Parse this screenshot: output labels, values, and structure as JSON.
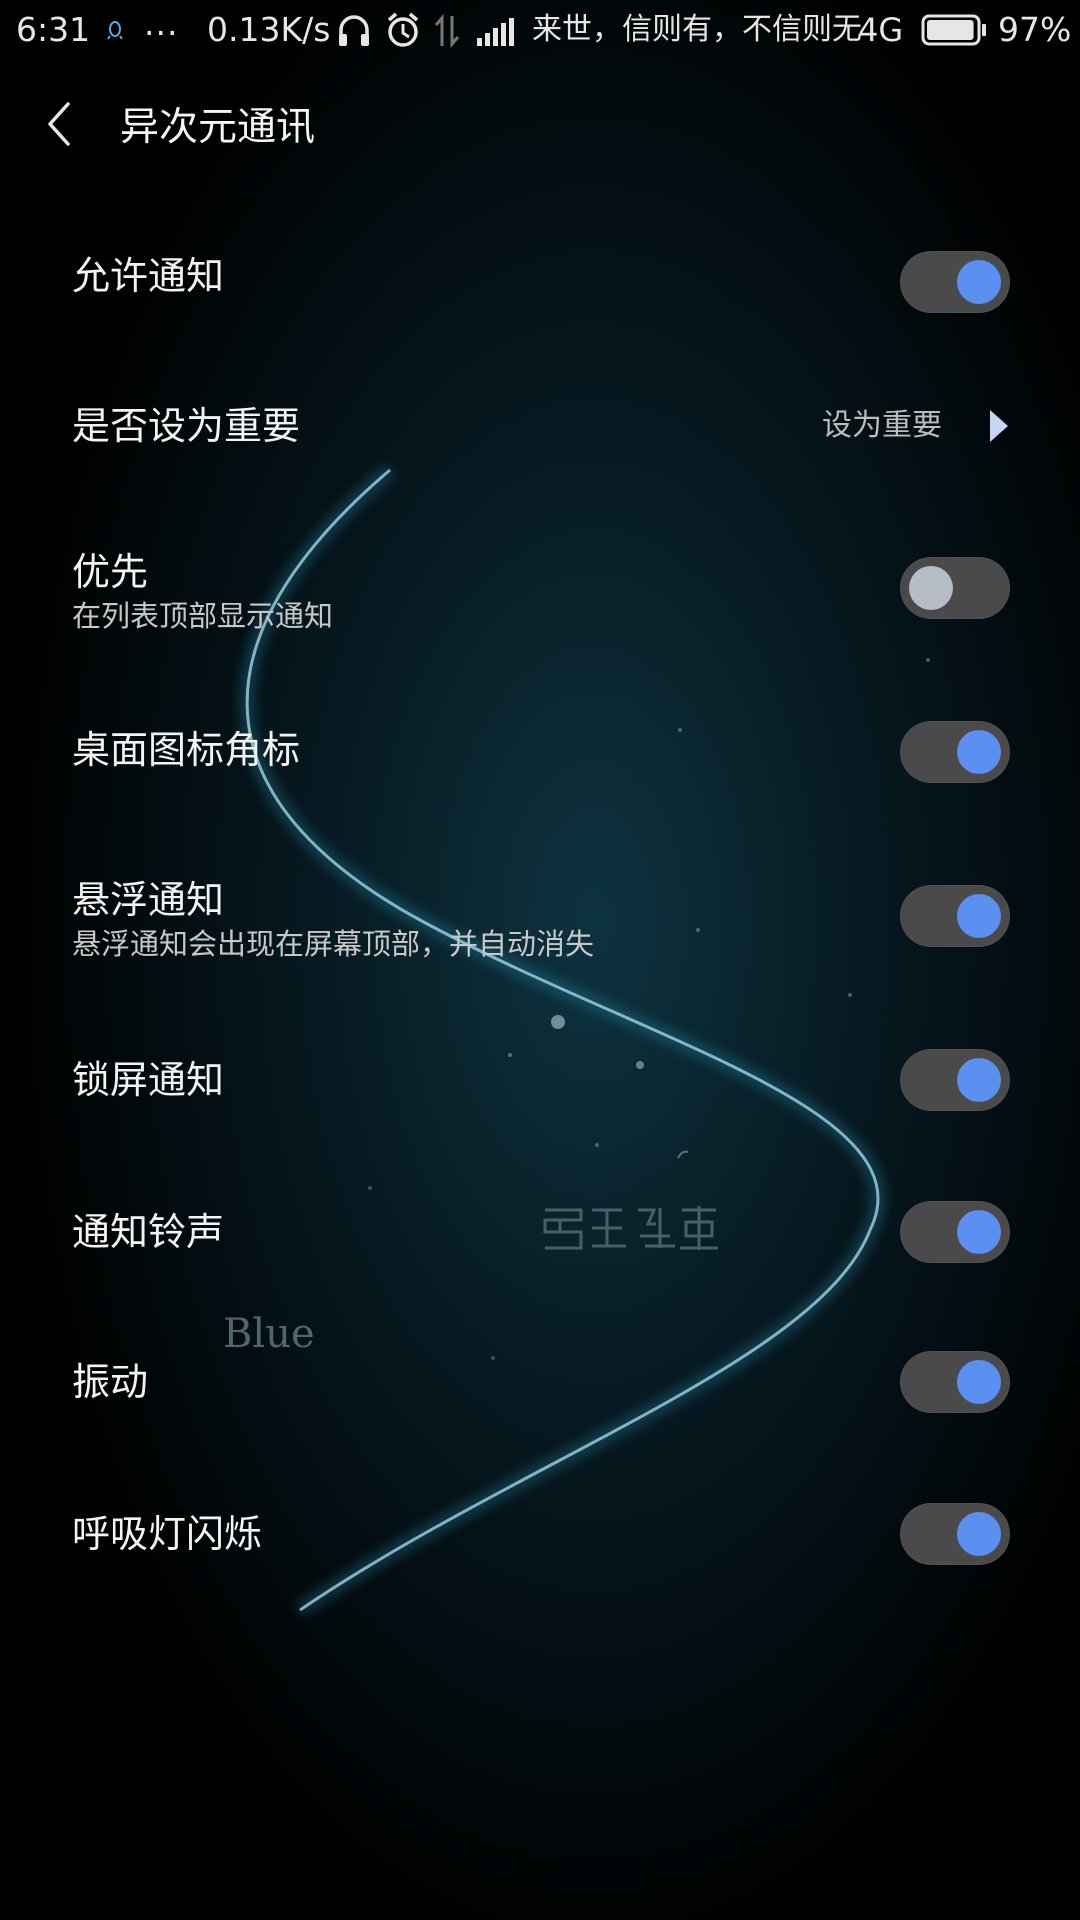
{
  "status_bar": {
    "time": "6:31",
    "dots": "...",
    "net_speed": "0.13K/s",
    "carrier": "来世，信则有，不信则无",
    "network": "4G",
    "battery": "97%",
    "battery_level": 0.97
  },
  "header": {
    "title": "异次元通讯"
  },
  "settings": [
    {
      "title": "允许通知",
      "enabled": true
    },
    {
      "title": "是否设为重要",
      "value": "设为重要"
    },
    {
      "title": "优先",
      "subtitle": "在列表顶部显示通知",
      "enabled": false
    },
    {
      "title": "桌面图标角标",
      "enabled": true
    },
    {
      "title": "悬浮通知",
      "subtitle": "悬浮通知会出现在屏幕顶部，并自动消失",
      "enabled": true
    },
    {
      "title": "锁屏通知",
      "enabled": true
    },
    {
      "title": "通知铃声",
      "enabled": true
    },
    {
      "title": "振动",
      "enabled": true
    },
    {
      "title": "呼吸灯闪烁",
      "enabled": true
    }
  ],
  "wallpaper": {
    "watermark": "Blue"
  },
  "colors": {
    "accent": "#5b8ff0",
    "toggle_track": "#4a4a4a",
    "toggle_off_knob": "#b5bcc6",
    "background": "#000000"
  }
}
